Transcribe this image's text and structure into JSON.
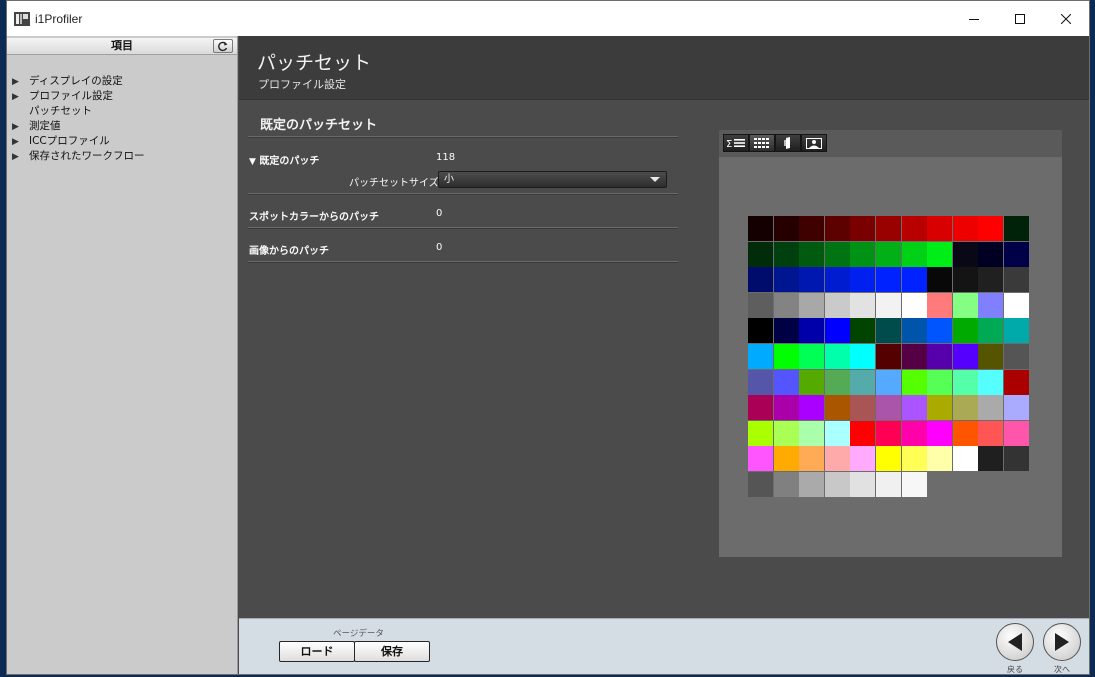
{
  "window": {
    "title": "i1Profiler"
  },
  "sidebar": {
    "header": "項目",
    "items": [
      {
        "label": "ディスプレイの設定",
        "arrow": true
      },
      {
        "label": "プロファイル設定",
        "arrow": true
      },
      {
        "label": "パッチセット",
        "arrow": false
      },
      {
        "label": "測定値",
        "arrow": true
      },
      {
        "label": "ICCプロファイル",
        "arrow": true
      },
      {
        "label": "保存されたワークフロー",
        "arrow": true
      }
    ]
  },
  "header": {
    "title": "パッチセット",
    "subtitle": "プロファイル設定"
  },
  "main": {
    "section_title": "既定のパッチセット",
    "default_patches": {
      "label": "既定のパッチ",
      "value": "118"
    },
    "patch_set_size": {
      "label": "パッチセットサイズ:",
      "value": "小"
    },
    "spot_color_patches": {
      "label": "スポットカラーからのパッチ",
      "value": "0"
    },
    "image_patches": {
      "label": "画像からのパッチ",
      "value": "0"
    }
  },
  "preview": {
    "toolbar": [
      "sum-list-icon",
      "grid-view-icon",
      "color-swatch-icon",
      "image-view-icon"
    ],
    "patch_colors": [
      "#140000",
      "#260000",
      "#3f0000",
      "#5c0000",
      "#7a0000",
      "#990000",
      "#b80000",
      "#d80000",
      "#ee0000",
      "#ff0000",
      "#002208",
      "#002c0a",
      "#00400e",
      "#005a10",
      "#007412",
      "#009214",
      "#00b016",
      "#00d016",
      "#00ee18",
      "#080816",
      "#000022",
      "#000048",
      "#000c6c",
      "#001590",
      "#0018b0",
      "#001cd0",
      "#0020f0",
      "#0022ff",
      "#0022ff",
      "#080808",
      "#141414",
      "#202020",
      "#3a3a3a",
      "#5e5e5e",
      "#838383",
      "#a8a8a8",
      "#cacaca",
      "#e2e2e2",
      "#f2f2f2",
      "#ffffff",
      "#ff7b7b",
      "#84ff84",
      "#8080ff",
      "#ffffff",
      "#000000",
      "#000044",
      "#0000aa",
      "#0000ff",
      "#004400",
      "#004c4c",
      "#0055aa",
      "#0055ff",
      "#00aa00",
      "#00aa55",
      "#00aaaa",
      "#00aaff",
      "#00ff00",
      "#00ff55",
      "#00ffaa",
      "#00ffff",
      "#550000",
      "#550044",
      "#5500aa",
      "#5500ff",
      "#555500",
      "#555555",
      "#5555aa",
      "#5555ff",
      "#55aa00",
      "#55aa55",
      "#55aaaa",
      "#55aaff",
      "#55ff00",
      "#55ff55",
      "#55ffaa",
      "#55ffff",
      "#aa0000",
      "#aa0055",
      "#aa00aa",
      "#aa00ff",
      "#aa5500",
      "#aa5555",
      "#aa55aa",
      "#aa55ff",
      "#aaaa00",
      "#aaaa55",
      "#aaaaaa",
      "#aaaaff",
      "#aaff00",
      "#aaff55",
      "#aaffaa",
      "#aaffff",
      "#ff0000",
      "#ff0055",
      "#ff00aa",
      "#ff00ff",
      "#ff5500",
      "#ff5555",
      "#ff55aa",
      "#ff55ff",
      "#ffaa00",
      "#ffaa55",
      "#ffaaaa",
      "#ffaaff",
      "#ffff00",
      "#ffff55",
      "#ffffaa",
      "#ffffff",
      "#1f1f1f",
      "#333333",
      "#555555",
      "#808080",
      "#aaaaaa",
      "#c8c8c8",
      "#e1e1e1",
      "#f0f0f0",
      "#f7f7f7"
    ]
  },
  "footer": {
    "page_data_label": "ページデータ",
    "load_label": "ロード",
    "save_label": "保存",
    "back_label": "戻る",
    "next_label": "次へ"
  }
}
